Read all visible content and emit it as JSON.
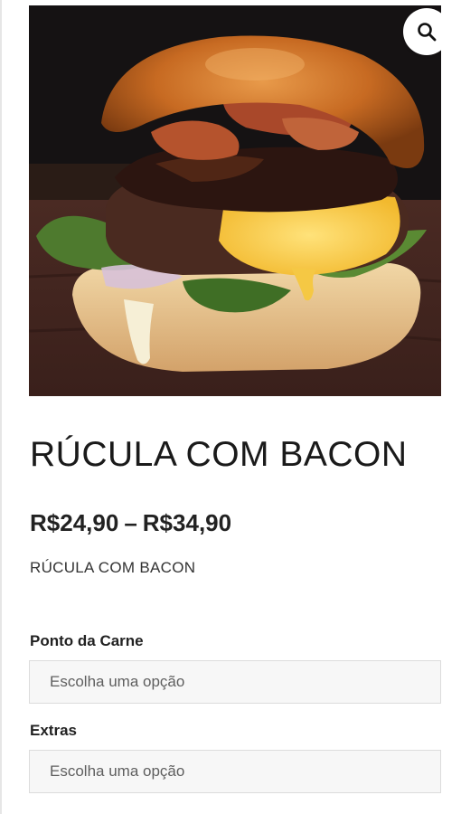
{
  "product": {
    "image_alt": "burger with rucula, bacon and cheese",
    "title": "RÚCULA COM BACON",
    "price_min": "R$24,90",
    "price_separator": "–",
    "price_max": "R$34,90",
    "short_description": "RÚCULA COM BACON"
  },
  "gallery": {
    "zoom_icon": "search-icon"
  },
  "variations": [
    {
      "label": "Ponto da Carne",
      "placeholder": "Escolha uma opção"
    },
    {
      "label": "Extras",
      "placeholder": "Escolha uma opção"
    }
  ]
}
